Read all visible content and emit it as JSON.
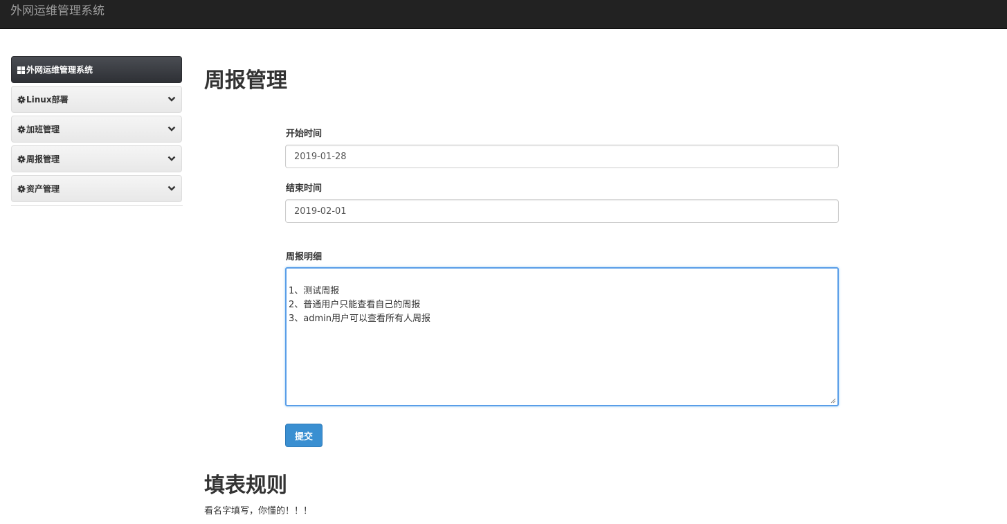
{
  "navbar": {
    "brand": "外网运维管理系统"
  },
  "sidebar": {
    "items": [
      {
        "label": "外网运维管理系统",
        "icon": "grid-icon",
        "active": true
      },
      {
        "label": "Linux部署",
        "icon": "gear-icon",
        "active": false
      },
      {
        "label": "加班管理",
        "icon": "gear-icon",
        "active": false
      },
      {
        "label": "周报管理",
        "icon": "gear-icon",
        "active": false
      },
      {
        "label": "资产管理",
        "icon": "gear-icon",
        "active": false
      }
    ]
  },
  "main": {
    "title": "周报管理",
    "form": {
      "start_label": "开始时间",
      "start_value": "2019-01-28",
      "end_label": "结束时间",
      "end_value": "2019-02-01",
      "detail_label": "周报明细",
      "detail_value": "1、测试周报\n2、普通用户只能查看自己的周报\n3、admin用户可以查看所有人周报",
      "submit_label": "提交"
    },
    "rules": {
      "title": "填表规则",
      "text": "看名字填写，你懂的！！！"
    }
  },
  "colors": {
    "navbar_bg": "#222222",
    "brand_text": "#9d9d9d",
    "primary": "#3a8fd1",
    "focus_border": "#5a9ee8",
    "active_sidebar": "#2e3035"
  }
}
